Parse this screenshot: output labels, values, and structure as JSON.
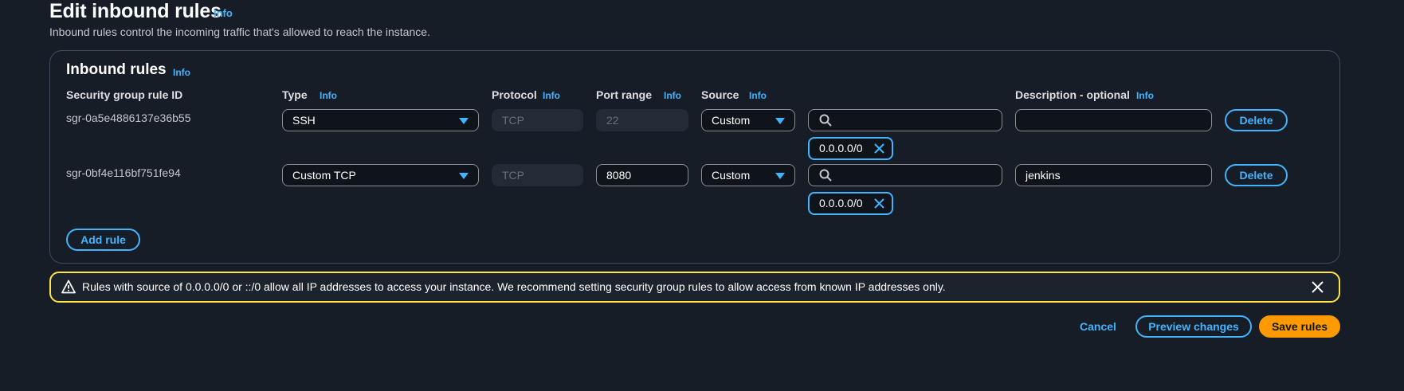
{
  "header": {
    "title": "Edit inbound rules",
    "info": "Info",
    "description": "Inbound rules control the incoming traffic that's allowed to reach the instance."
  },
  "panel": {
    "title": "Inbound rules",
    "info": "Info",
    "columns": {
      "rule_id": "Security group rule ID",
      "type": "Type",
      "protocol": "Protocol",
      "port_range": "Port range",
      "source": "Source",
      "description": "Description - optional"
    },
    "column_info": "Info",
    "rules": [
      {
        "id": "sgr-0a5e4886137e36b55",
        "type": "SSH",
        "protocol": "TCP",
        "port_range": "22",
        "source_type": "Custom",
        "source_search": "",
        "cidr": "0.0.0.0/0",
        "description": "",
        "delete_label": "Delete"
      },
      {
        "id": "sgr-0bf4e116bf751fe94",
        "type": "Custom TCP",
        "protocol": "TCP",
        "port_range": "8080",
        "source_type": "Custom",
        "source_search": "",
        "cidr": "0.0.0.0/0",
        "description": "jenkins",
        "delete_label": "Delete"
      }
    ],
    "add_rule_label": "Add rule"
  },
  "alert": {
    "text": "Rules with source of 0.0.0.0/0 or ::/0 allow all IP addresses to access your instance. We recommend setting security group rules to allow access from known IP addresses only.",
    "icon": "warning-icon"
  },
  "footer": {
    "cancel_label": "Cancel",
    "preview_label": "Preview changes",
    "save_label": "Save rules"
  },
  "colors": {
    "background": "#161d26",
    "accent": "#42b4ff",
    "primary": "#ff9900",
    "warning": "#ffe347"
  }
}
